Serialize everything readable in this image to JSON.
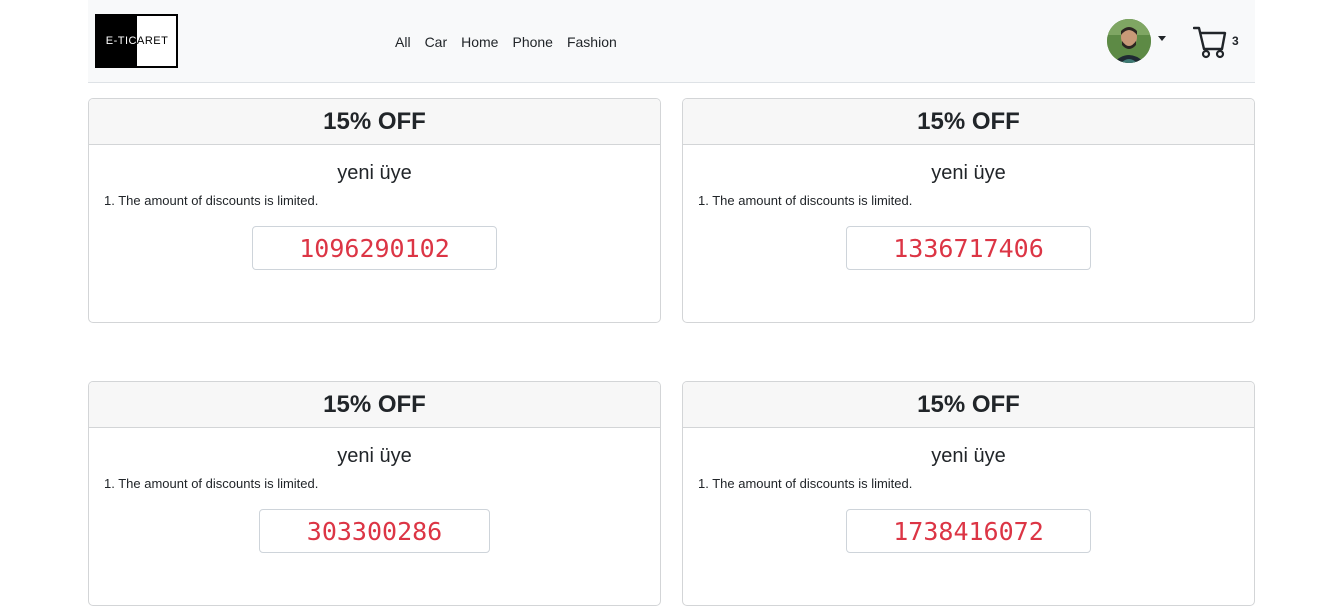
{
  "brand": {
    "logo_left": "E-TIC",
    "logo_right": "ARET"
  },
  "nav": {
    "links": [
      "All",
      "Car",
      "Home",
      "Phone",
      "Fashion"
    ]
  },
  "user": {
    "avatar_icon": "user-avatar"
  },
  "cart": {
    "count": "3",
    "icon": "cart-icon"
  },
  "coupons": [
    {
      "header": "15% OFF",
      "title": "yeni üye",
      "rule": "1. The amount of discounts is limited.",
      "code": "1096290102"
    },
    {
      "header": "15% OFF",
      "title": "yeni üye",
      "rule": "1. The amount of discounts is limited.",
      "code": "1336717406"
    },
    {
      "header": "15% OFF",
      "title": "yeni üye",
      "rule": "1. The amount of discounts is limited.",
      "code": "303300286"
    },
    {
      "header": "15% OFF",
      "title": "yeni üye",
      "rule": "1. The amount of discounts is limited.",
      "code": "1738416072"
    }
  ],
  "colors": {
    "code_text": "#dc3545",
    "navbar_bg": "#f8f9fa",
    "card_header_bg": "#f7f7f7"
  }
}
